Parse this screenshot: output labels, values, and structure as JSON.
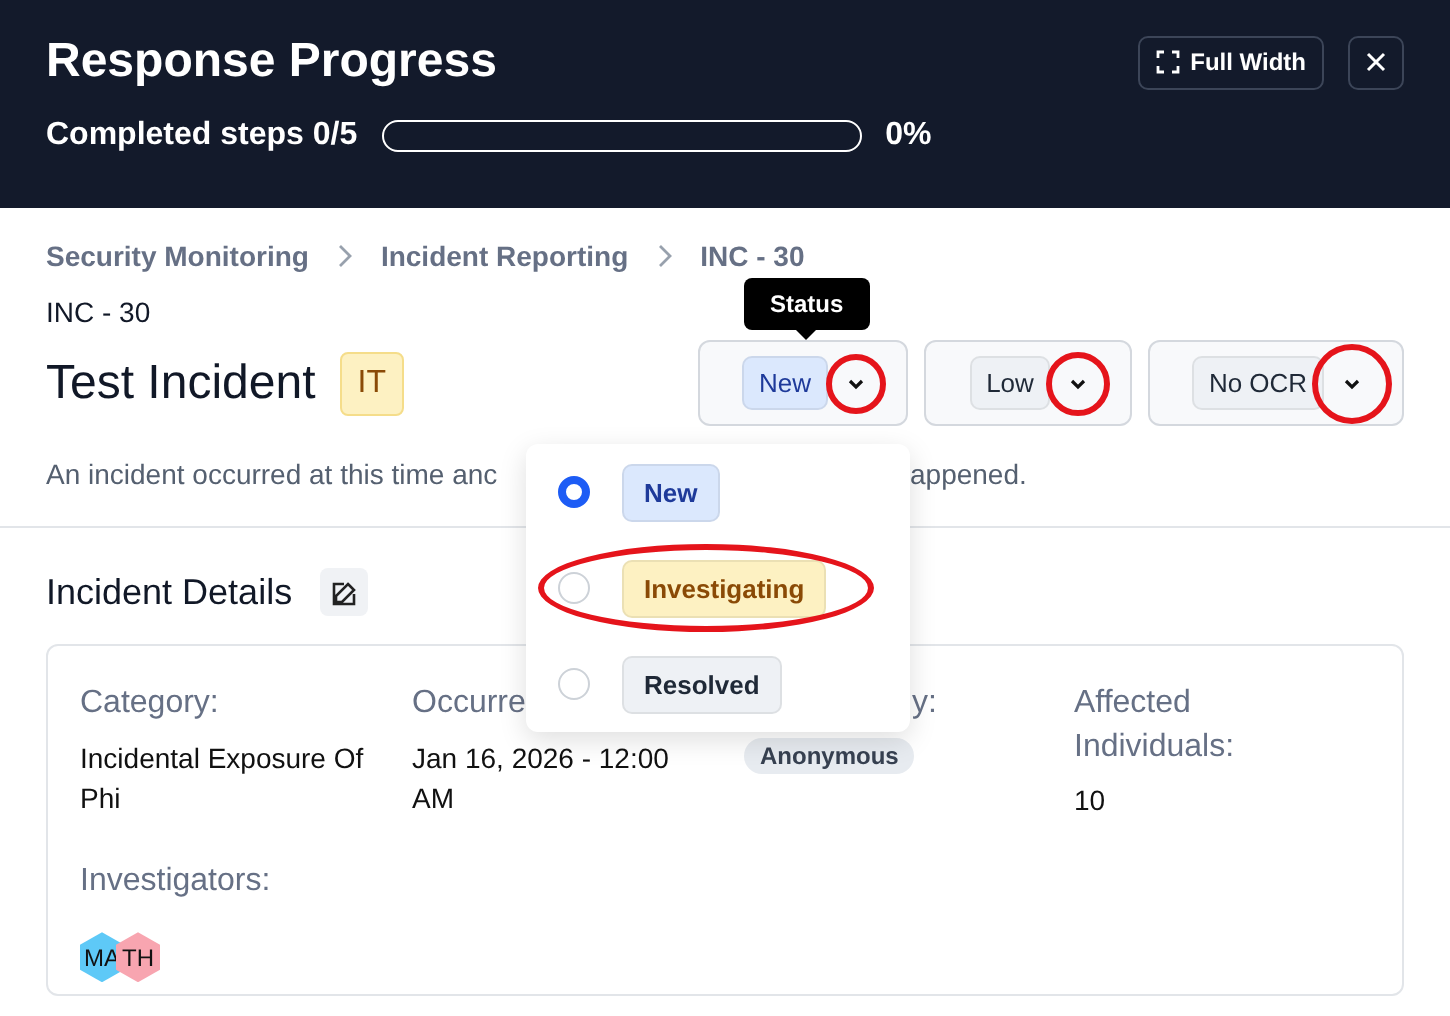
{
  "header": {
    "title": "Response Progress",
    "full_width_button": "Full Width",
    "progress": {
      "label": "Completed steps 0/5",
      "level": 0,
      "reading": "0%"
    }
  },
  "breadcrumbs": [
    "Security Monitoring",
    "Incident Reporting",
    "INC - 30"
  ],
  "incident": {
    "id": "INC - 30",
    "title": "Test Incident",
    "tag": "IT",
    "description_parts": [
      "An incident occurred at this time anc",
      "appened."
    ]
  },
  "selects": [
    {
      "label": "New",
      "color": "#dbe8fd",
      "circled": true
    },
    {
      "label": "Low",
      "color": "#eef1f5",
      "circled": true
    },
    {
      "label": "No OCR",
      "color": "#eef1f5",
      "circled": true
    }
  ],
  "tooltip": "Status",
  "menu": {
    "options": [
      {
        "label": "New",
        "color": "#dbe8fd",
        "selected": true,
        "circled": false
      },
      {
        "label": "Investigating",
        "color": "#fdf1c2",
        "selected": false,
        "circled": true
      },
      {
        "label": "Resolved",
        "color": "#eef1f5",
        "selected": false,
        "circled": false
      }
    ]
  },
  "details": {
    "title": "Incident Details",
    "fields": [
      {
        "label": "Category:",
        "kind": "text",
        "value": "Incidental Exposure Of Phi"
      },
      {
        "label": "Occurre",
        "kind": "text",
        "value": "Jan 16, 2026 - 12:00 AM"
      },
      {
        "label": "y:",
        "kind": "badge",
        "value": "Anonymous",
        "cut": true
      },
      {
        "label": "Affected Individuals:",
        "kind": "text",
        "value": "10"
      }
    ],
    "investigators_label": "Investigators:",
    "investigators": [
      {
        "initials": "MA",
        "color": "#5ec9f7"
      },
      {
        "initials": "TH",
        "color": "#f8a5b0"
      }
    ]
  }
}
